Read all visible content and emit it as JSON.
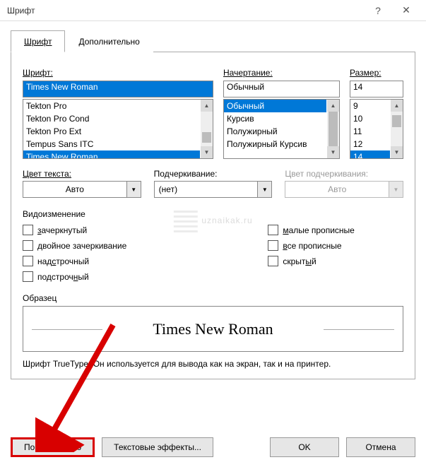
{
  "window": {
    "title": "Шрифт",
    "help_icon": "?",
    "close_icon": "✕"
  },
  "tabs": {
    "font": "Шрифт",
    "advanced": "Дополнительно"
  },
  "labels": {
    "font": "Шрифт:",
    "style": "Начертание:",
    "size": "Размер:",
    "font_color": "Цвет текста:",
    "underline": "Подчеркивание:",
    "underline_color": "Цвет подчеркивания:",
    "effects": "Видоизменение",
    "sample": "Образец"
  },
  "font": {
    "value": "Times New Roman",
    "list": [
      "Tekton Pro",
      "Tekton Pro Cond",
      "Tekton Pro Ext",
      "Tempus Sans ITC",
      "Times New Roman"
    ]
  },
  "style": {
    "value": "Обычный",
    "list": [
      "Обычный",
      "Курсив",
      "Полужирный",
      "Полужирный Курсив"
    ]
  },
  "size": {
    "value": "14",
    "list": [
      "9",
      "10",
      "11",
      "12",
      "14"
    ]
  },
  "color": {
    "value": "Авто"
  },
  "underline": {
    "value": "(нет)"
  },
  "underline_color": {
    "value": "Авто"
  },
  "effects": {
    "strikethrough": "зачеркнутый",
    "double_strike": "двойное зачеркивание",
    "superscript": "надстрочный",
    "subscript": "подстрочный",
    "small_caps": "малые прописные",
    "all_caps": "все прописные",
    "hidden": "скрытый"
  },
  "sample": {
    "text": "Times New Roman"
  },
  "description": "Шрифт TrueType. Он используется для вывода как на экран, так и на принтер.",
  "buttons": {
    "default": "По умолчанию",
    "text_effects": "Текстовые эффекты...",
    "ok": "OK",
    "cancel": "Отмена"
  },
  "watermark": "uznaikak.ru"
}
